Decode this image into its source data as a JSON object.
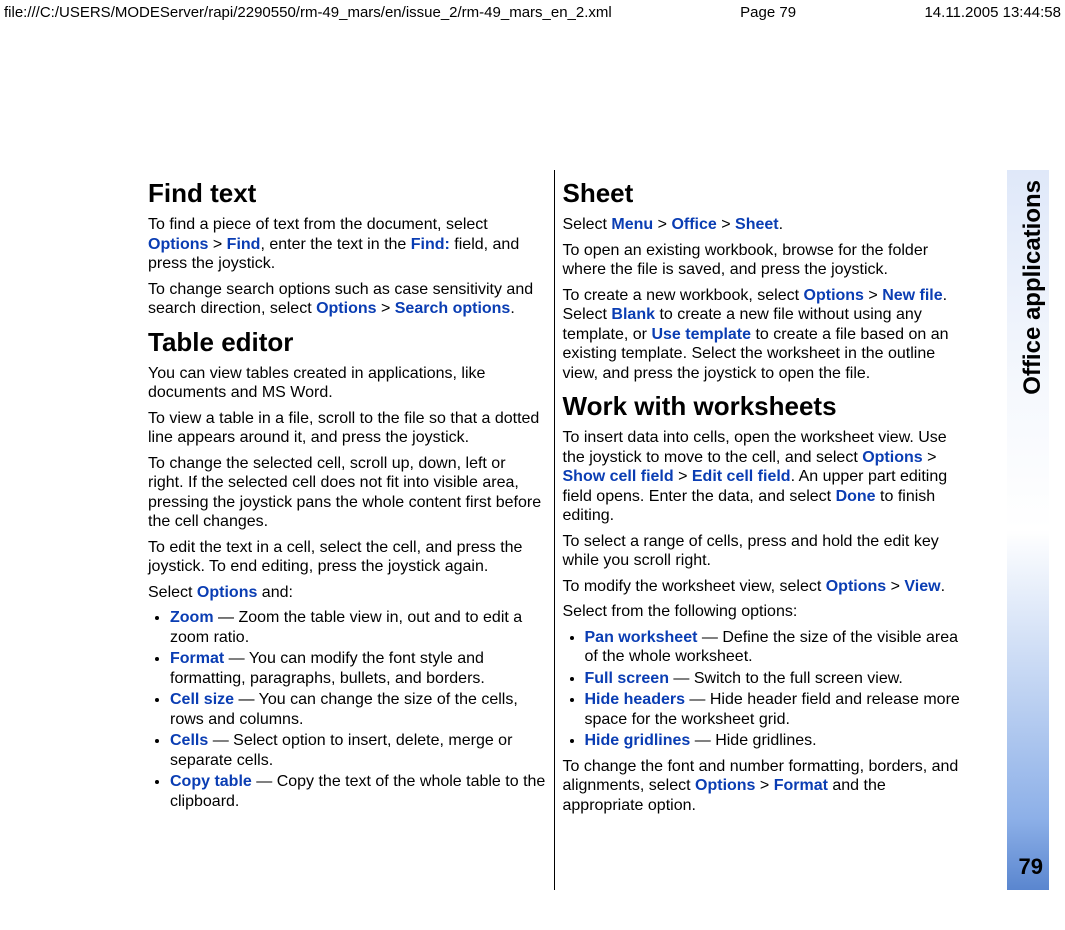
{
  "header": {
    "path": "file:///C:/USERS/MODEServer/rapi/2290550/rm-49_mars/en/issue_2/rm-49_mars_en_2.xml",
    "page": "Page 79",
    "datetime": "14.11.2005 13:44:58"
  },
  "side": {
    "label": "Office applications",
    "page_no": "79"
  },
  "left": {
    "h1": "Find text",
    "p1a": "To find a piece of text from the document, select ",
    "p1_opt1": "Options",
    "p1_gt1": " > ",
    "p1_opt2": "Find",
    "p1b": ", enter the text in the ",
    "p1_opt3": "Find:",
    "p1c": " field, and press the joystick.",
    "p2a": "To change search options such as case sensitivity and search direction, select ",
    "p2_opt1": "Options",
    "p2_gt1": " > ",
    "p2_opt2": "Search options",
    "p2b": ".",
    "h2": "Table editor",
    "p3": "You can view tables created in applications, like documents and MS Word.",
    "p4": "To view a table in a file, scroll to the file so that a dotted line appears around it, and press the joystick.",
    "p5": "To change the selected cell, scroll up, down, left or right. If the selected cell does not fit into visible area, pressing the joystick pans the whole content first before the cell changes.",
    "p6": "To edit the text in a cell, select the cell, and press the joystick. To end editing, press the joystick again.",
    "p7a": "Select ",
    "p7_opt": "Options",
    "p7b": " and:",
    "li1_opt": "Zoom",
    "li1_txt": " — Zoom the table view in, out and to edit a zoom ratio.",
    "li2_opt": "Format",
    "li2_txt": " — You can modify the font style and formatting, paragraphs, bullets, and borders.",
    "li3_opt": "Cell size",
    "li3_txt": " — You can change the size of the cells, rows and columns.",
    "li4_opt": "Cells",
    "li4_txt": " — Select option to insert, delete, merge or separate cells.",
    "li5_opt": "Copy table",
    "li5_txt": " — Copy the text of the whole table to the clipboard."
  },
  "right": {
    "h1": "Sheet",
    "p1a": "Select ",
    "p1_opt1": "Menu",
    "p1_gt1": " > ",
    "p1_opt2": "Office",
    "p1_gt2": " > ",
    "p1_opt3": "Sheet",
    "p1b": ".",
    "p2": "To open an existing workbook, browse for the folder where the file is saved, and press the joystick.",
    "p3a": "To create a new workbook, select ",
    "p3_opt1": "Options",
    "p3_gt1": " > ",
    "p3_opt2": "New file",
    "p3b": ". Select ",
    "p3_opt3": "Blank",
    "p3c": " to create a new file without using any template, or ",
    "p3_opt4": "Use template",
    "p3d": " to create a file based on an existing template. Select the worksheet in the outline view, and press the joystick to open the file.",
    "h2": "Work with worksheets",
    "p4a": "To insert data into cells, open the worksheet view. Use the joystick to move to the cell, and select ",
    "p4_opt1": "Options",
    "p4_gt1": " > ",
    "p4_opt2": "Show cell field",
    "p4_gt2": " > ",
    "p4_opt3": "Edit cell field",
    "p4b": ". An upper part editing field opens. Enter the data, and select ",
    "p4_opt4": "Done",
    "p4c": " to finish editing.",
    "p5": "To select a range of cells, press and hold the edit key while you scroll right.",
    "p6a": "To modify the worksheet view, select ",
    "p6_opt1": "Options",
    "p6_gt1": " > ",
    "p6_opt2": "View",
    "p6b": ".",
    "p7": "Select from the following options:",
    "li1_opt": "Pan worksheet",
    "li1_txt": " — Define the size of the visible area of the whole worksheet.",
    "li2_opt": "Full screen",
    "li2_txt": " — Switch to the full screen view.",
    "li3_opt": "Hide headers",
    "li3_txt": " — Hide header field and release more space for the worksheet grid.",
    "li4_opt": "Hide gridlines",
    "li4_txt": " — Hide gridlines.",
    "p8a": "To change the font and number formatting, borders, and alignments, select ",
    "p8_opt1": "Options",
    "p8_gt1": " > ",
    "p8_opt2": "Format",
    "p8b": " and the appropriate option."
  }
}
